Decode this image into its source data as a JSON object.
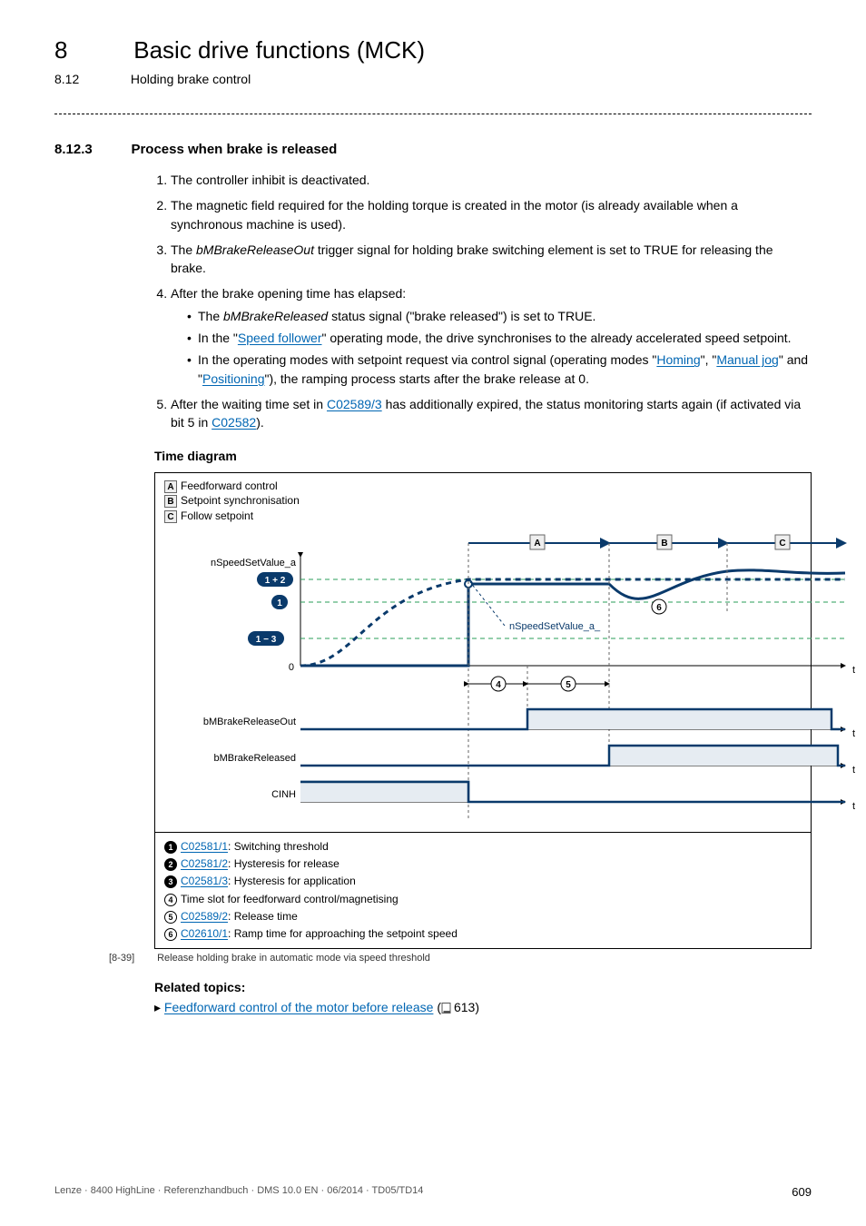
{
  "chapter": {
    "num": "8",
    "title": "Basic drive functions (MCK)"
  },
  "section": {
    "num": "8.12",
    "title": "Holding brake control"
  },
  "subsection": {
    "num": "8.12.3",
    "title": "Process when brake is released"
  },
  "list": {
    "i1": "The controller inhibit is deactivated.",
    "i2": "The magnetic field required for the holding torque is created in the motor (is already available when a synchronous machine is used).",
    "i3a": "The ",
    "i3b": "bMBrakeReleaseOut",
    "i3c": " trigger signal for holding brake switching element is set to TRUE for releasing the brake.",
    "i4": "After the brake opening time has elapsed:",
    "i4s1a": "The ",
    "i4s1b": "bMBrakeReleased",
    "i4s1c": " status signal (\"brake released\") is set to TRUE.",
    "i4s2a": "In the \"",
    "i4s2link": "Speed follower",
    "i4s2b": "\" operating mode, the drive synchronises to the already accelerated speed setpoint.",
    "i4s3a": "In the operating modes with setpoint request via control signal (operating modes \"",
    "i4s3l1": "Homing",
    "i4s3b": "\", \"",
    "i4s3l2": "Manual jog",
    "i4s3c": "\" and \"",
    "i4s3l3": "Positioning",
    "i4s3d": "\"), the ramping process starts after the brake release at 0.",
    "i5a": "After the waiting time set in ",
    "i5l1": "C02589/3",
    "i5b": " has additionally expired, the status monitoring starts again (if activated via bit 5 in ",
    "i5l2": "C02582",
    "i5c": ")."
  },
  "timeDiagram": "Time diagram",
  "legendTop": {
    "a": "Feedforward control",
    "b": "Setpoint synchronisation",
    "c": "Follow setpoint"
  },
  "svg": {
    "nSpeedSetValue_a": "nSpeedSetValue_a",
    "bMBrakeReleaseOut": "bMBrakeReleaseOut",
    "bMBrakeReleased": "bMBrakeReleased",
    "CINH": "CINH",
    "zero": "0",
    "pill1": "1 + 2",
    "pill2": "1",
    "pill3": "1 − 3",
    "A": "A",
    "B": "B",
    "C": "C",
    "m4": "4",
    "m5": "5",
    "m6": "6",
    "t": "t"
  },
  "legendBottom": {
    "l1": {
      "link": "C02581/1",
      "text": ": Switching threshold"
    },
    "l2": {
      "link": "C02581/2",
      "text": ": Hysteresis for release"
    },
    "l3": {
      "link": "C02581/3",
      "text": ": Hysteresis for application"
    },
    "l4": {
      "text": "Time slot for feedforward control/magnetising"
    },
    "l5": {
      "link": "C02589/2",
      "text": ": Release time"
    },
    "l6": {
      "link": "C02610/1",
      "text": ": Ramp time for approaching the setpoint speed"
    }
  },
  "caption": {
    "num": "[8-39]",
    "text": "Release holding brake in automatic mode via speed threshold"
  },
  "related": {
    "heading": "Related topics:",
    "link": "Feedforward control of the motor before release",
    "page": "613"
  },
  "footer": {
    "left": "Lenze · 8400 HighLine · Referenzhandbuch · DMS 10.0 EN · 06/2014 · TD05/TD14",
    "page": "609"
  }
}
